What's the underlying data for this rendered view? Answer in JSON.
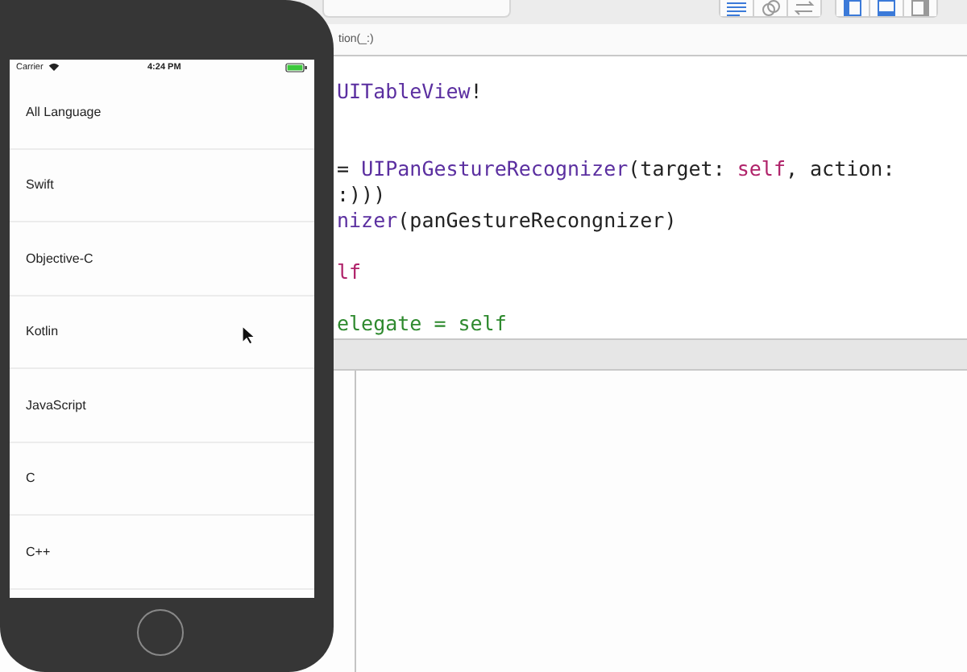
{
  "editor": {
    "jump_bar": "tion(_:)",
    "code_lines": [
      {
        "kind": "code",
        "tokens": [
          {
            "text": "UITableView",
            "kind": "type"
          },
          {
            "text": "!",
            "kind": "plain"
          }
        ]
      },
      {
        "kind": "blank"
      },
      {
        "kind": "blank"
      },
      {
        "kind": "code",
        "tokens": [
          {
            "text": "= ",
            "kind": "plain"
          },
          {
            "text": "UIPanGestureRecognizer",
            "kind": "type"
          },
          {
            "text": "(target: ",
            "kind": "plain"
          },
          {
            "text": "self",
            "kind": "keyword"
          },
          {
            "text": ", action:",
            "kind": "plain"
          }
        ]
      },
      {
        "kind": "code",
        "tokens": [
          {
            "text": ":)))",
            "kind": "plain"
          }
        ]
      },
      {
        "kind": "code",
        "tokens": [
          {
            "text": "nizer",
            "kind": "type"
          },
          {
            "text": "(panGestureRecongnizer)",
            "kind": "plain"
          }
        ]
      },
      {
        "kind": "blank"
      },
      {
        "kind": "code",
        "tokens": [
          {
            "text": "lf",
            "kind": "keyword"
          }
        ]
      },
      {
        "kind": "blank"
      },
      {
        "kind": "code",
        "tokens": [
          {
            "text": "elegate = self",
            "kind": "comment"
          }
        ]
      }
    ]
  },
  "simulator": {
    "status_bar": {
      "carrier": "Carrier",
      "time": "4:24 PM"
    },
    "rows": [
      {
        "label": "All Language"
      },
      {
        "label": "Swift"
      },
      {
        "label": "Objective-C"
      },
      {
        "label": "Kotlin"
      },
      {
        "label": "JavaScript"
      },
      {
        "label": "C"
      },
      {
        "label": "C++"
      }
    ]
  }
}
